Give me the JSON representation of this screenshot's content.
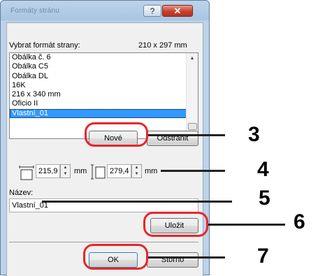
{
  "dialog": {
    "title": "Formáty stránu",
    "help_glyph": "?",
    "close_glyph": "✕"
  },
  "format": {
    "label": "Vybrat formát strany:",
    "size": "210 x 297 mm",
    "items": [
      "Obálka č. 6",
      "Obálka C5",
      "Obálka DL",
      "16K",
      "216 x 340 mm",
      "Oficio II",
      "Vlastní_01"
    ],
    "selected_index": 6
  },
  "buttons": {
    "new": "Nové",
    "delete": "Odstranit",
    "save": "Uložit",
    "ok": "OK",
    "cancel": "Storno"
  },
  "dimensions": {
    "width": "215,9",
    "height": "279,4",
    "unit": "mm"
  },
  "name": {
    "label": "Název:",
    "value": "Vlastní_01"
  },
  "callouts": [
    "3",
    "4",
    "5",
    "6",
    "7"
  ],
  "colors": {
    "highlight_ring": "#e8262b",
    "selection": "#3399ff"
  }
}
